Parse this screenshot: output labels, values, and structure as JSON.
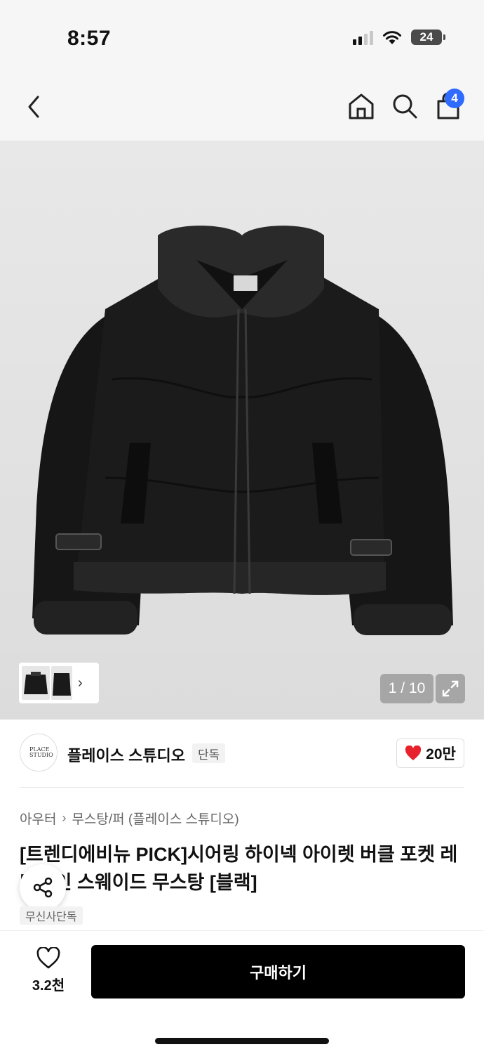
{
  "status": {
    "time": "8:57",
    "battery": "24"
  },
  "nav": {
    "cart_count": "4"
  },
  "gallery": {
    "counter": "1 / 10"
  },
  "brand": {
    "name": "플레이스 스튜디오",
    "tag": "단독",
    "logo_text": "PLACE STUDIO",
    "likes": "20만"
  },
  "breadcrumb": {
    "category": "아우터",
    "subcategory": "무스탕/퍼 (플레이스 스튜디오)"
  },
  "product": {
    "title": "[트렌디에비뉴 PICK]시어링 하이넥 아이렛 버클 포켓 레더라인 스웨이드 무스탕 [블랙]",
    "badge": "무신사단독"
  },
  "bottom": {
    "wish_count": "3.2천",
    "buy_label": "구매하기"
  },
  "colors": {
    "accent": "#2f6bff",
    "heart": "#e8222d",
    "buy": "#000000"
  }
}
